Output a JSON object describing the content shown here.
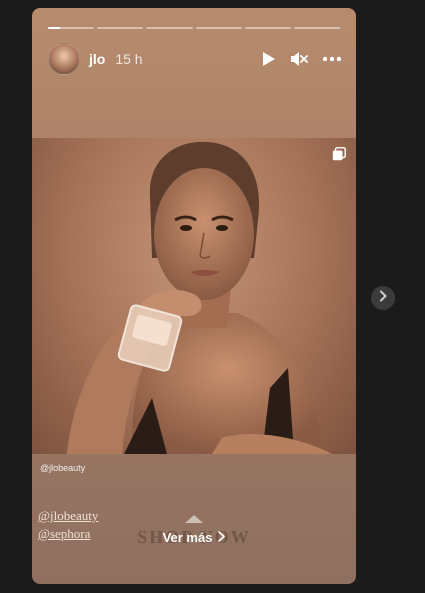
{
  "story": {
    "progress": {
      "segments": 6,
      "active_index": 0,
      "active_fraction": 0.25
    },
    "header": {
      "username": "jlo",
      "time_ago": "15 h",
      "avatar_icon": "profile-avatar",
      "controls": [
        "play-icon",
        "mute-icon",
        "more-icon"
      ]
    },
    "photo": {
      "credit": "@jlobeauty",
      "collection_icon": "collection-icon"
    },
    "mentions": [
      "@jlobeauty",
      "@sephora"
    ],
    "watermark": "SHOP NOW",
    "cta": {
      "label": "Ver más",
      "icon": "chevron-right-icon"
    }
  },
  "nav": {
    "next_icon": "chevron-right-icon"
  },
  "colors": {
    "page_bg": "#1b1b1b",
    "story_bg": "#b78b6d",
    "nav_btn_bg": "#3b3b3b"
  }
}
